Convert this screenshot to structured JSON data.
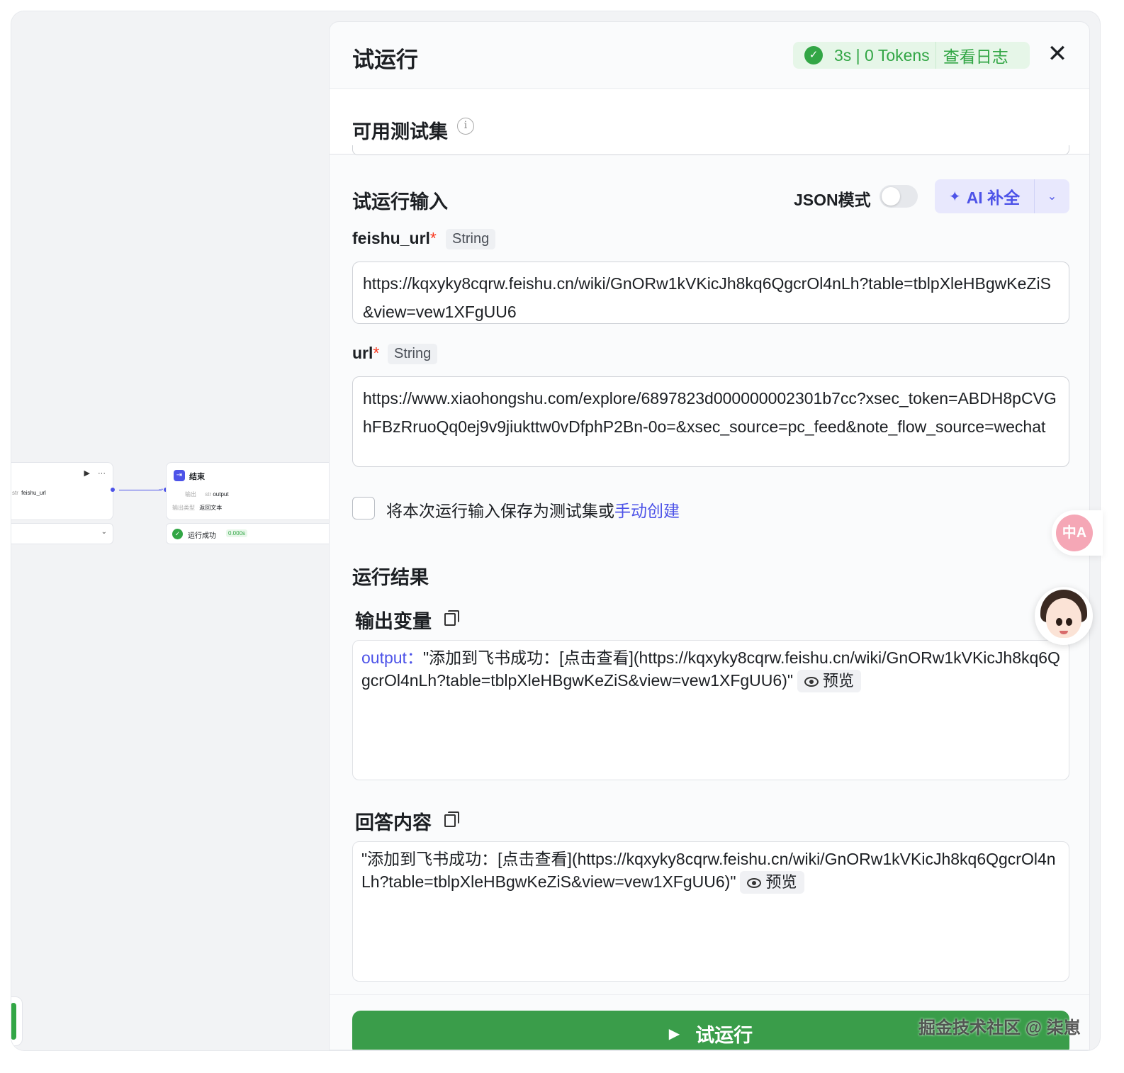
{
  "canvas": {
    "node_a": {
      "play_icon": "▶",
      "more_icon": "···",
      "param_tag": "str",
      "param_name": "feishu_url",
      "select_chevron": "⌄"
    },
    "node_end": {
      "icon": "⇥",
      "title": "结束",
      "output_label": "输出",
      "output_tag": "str",
      "output_value": "output",
      "type_label": "输出类型",
      "type_value": "返回文本"
    },
    "status": {
      "text": "运行成功",
      "time": "0.000s"
    }
  },
  "panel": {
    "title": "试运行",
    "stats": {
      "text": "3s | 0 Tokens",
      "log_link": "查看日志"
    },
    "close_icon": "✕",
    "testset": {
      "label": "可用测试集",
      "info_icon": "i"
    },
    "run_input": {
      "label": "试运行输入",
      "json_mode_label": "JSON模式",
      "ai_button_label": "AI 补全",
      "ai_spark_icon": "✦",
      "ai_dropdown_icon": "⌄"
    },
    "fields": [
      {
        "name": "feishu_url",
        "required_mark": "*",
        "type": "String",
        "value": "https://kqxyky8cqrw.feishu.cn/wiki/GnORw1kVKicJh8kq6QgcrOl4nLh?table=tblpXleHBgwKeZiS&view=vew1XFgUU6"
      },
      {
        "name": "url",
        "required_mark": "*",
        "type": "String",
        "value": "https://www.xiaohongshu.com/explore/6897823d000000002301b7cc?xsec_token=ABDH8pCVGhFBzRruoQq0ej9v9jiukttw0vDfphP2Bn-0o=&xsec_source=pc_feed&note_flow_source=wechat"
      }
    ],
    "save": {
      "text": "将本次运行输入保存为测试集或",
      "link": "手动创建"
    },
    "result": {
      "label": "运行结果",
      "output_vars_label": "输出变量",
      "output_key": "output：",
      "output_value": "\"添加到飞书成功：[点击查看](https://kqxyky8cqrw.feishu.cn/wiki/GnORw1kVKicJh8kq6QgcrOl4nLh?table=tblpXleHBgwKeZiS&view=vew1XFgUU6)\"",
      "preview_label": "预览",
      "answer_label": "回答内容",
      "answer_value": "\"添加到飞书成功：[点击查看](https://kqxyky8cqrw.feishu.cn/wiki/GnORw1kVKicJh8kq6QgcrOl4nLh?table=tblpXleHBgwKeZiS&view=vew1XFgUU6)\""
    },
    "run_button": {
      "label": "试运行",
      "icon": "▶"
    }
  },
  "floating": {
    "translate_icon": "中A"
  },
  "watermark": "掘金技术社区 @ 柒崽",
  "colors": {
    "accent": "#4d53e8",
    "success": "#32a645",
    "run_button": "#3a9d4a",
    "required": "#f93920"
  }
}
